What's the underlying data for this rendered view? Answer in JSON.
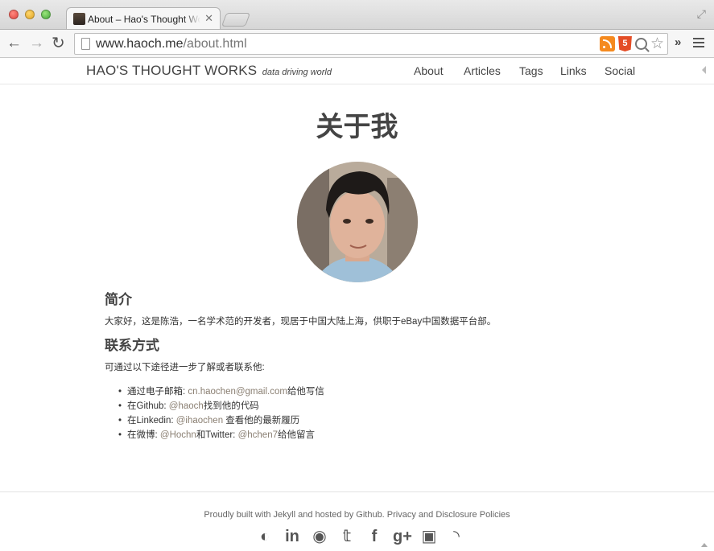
{
  "browser": {
    "tab_title": "About – Hao's Thought Works",
    "tab_close": "✕",
    "url_host": "www.haoch.me",
    "url_path": "/about.html",
    "html5_label": "5",
    "extensions_label": "»"
  },
  "site": {
    "brand_name": "HAO'S THOUGHT WORKS",
    "brand_tagline": "data driving world",
    "nav": [
      "About",
      "Articles",
      "Tags",
      "Links",
      "Social"
    ]
  },
  "main": {
    "title": "关于我",
    "intro_heading": "简介",
    "intro_text": "大家好，这是陈浩，一名学术范的开发者，现居于中国大陆上海，供职于eBay中国数据平台部。",
    "contact_heading": "联系方式",
    "contact_lead": "可通过以下途径进一步了解或者联系他:",
    "contacts": [
      {
        "pre": "通过电子邮箱: ",
        "link": "cn.haochen@gmail.com",
        "post": "给他写信"
      },
      {
        "pre": "在Github: ",
        "link": "@haoch",
        "post": "找到他的代码"
      },
      {
        "pre": "在Linkedin: ",
        "link": "@ihaochen",
        "post": " 查看他的最新履历"
      },
      {
        "pre": "在微博: ",
        "link": "@Hochn",
        "post": "和Twitter: ",
        "link2": "@hchen7",
        "post2": "给他留言"
      }
    ]
  },
  "footer": {
    "text": "Proudly built with Jekyll and hosted by Github. Privacy and Disclosure Policies",
    "social_icons": [
      "github-icon",
      "linkedin-icon",
      "weibo-icon",
      "twitter-icon",
      "facebook-icon",
      "google-plus-icon",
      "instagram-icon",
      "rss-icon"
    ],
    "social_glyphs": [
      "◐",
      "in",
      "◉",
      "𝕥",
      "f",
      "g+",
      "▣",
      "◝"
    ]
  }
}
